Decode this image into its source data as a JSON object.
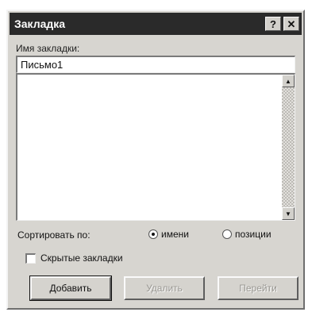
{
  "dialog": {
    "title": "Закладка",
    "help_label": "?",
    "close_label": "✕"
  },
  "name_field": {
    "label": "Имя закладки:",
    "value": "Письмо1"
  },
  "list": {
    "scroll_up": "▲",
    "scroll_down": "▼"
  },
  "sort": {
    "label": "Сортировать по:",
    "options": [
      {
        "label": "имени",
        "checked": true
      },
      {
        "label": "позиции",
        "checked": false
      }
    ]
  },
  "hidden_bookmarks": {
    "label": "Скрытые закладки",
    "checked": false
  },
  "buttons": {
    "add": "Добавить",
    "delete": "Удалить",
    "go": "Перейти"
  }
}
